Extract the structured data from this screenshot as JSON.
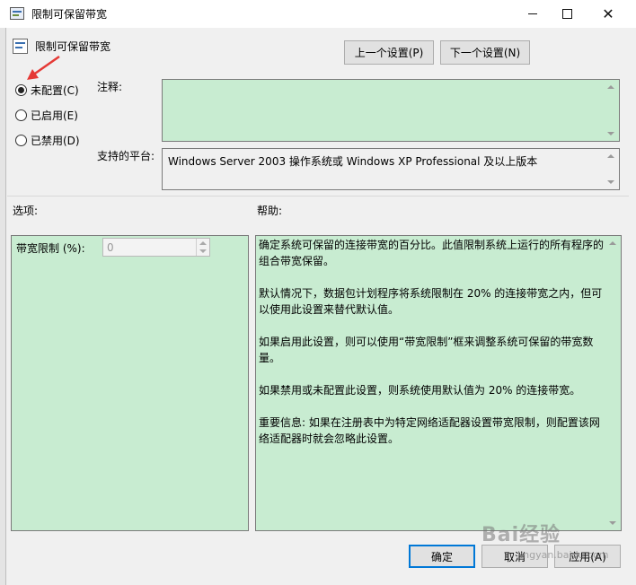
{
  "window": {
    "title": "限制可保留带宽"
  },
  "policy": {
    "title": "限制可保留带宽"
  },
  "nav": {
    "prev_label": "上一个设置(P)",
    "next_label": "下一个设置(N)"
  },
  "state": {
    "options": [
      {
        "label": "未配置(C)",
        "checked": true
      },
      {
        "label": "已启用(E)",
        "checked": false
      },
      {
        "label": "已禁用(D)",
        "checked": false
      }
    ]
  },
  "comment": {
    "label": "注释:",
    "value": ""
  },
  "platform": {
    "label": "支持的平台:",
    "value": "Windows Server 2003 操作系统或 Windows XP Professional 及以上版本"
  },
  "options_section": {
    "label": "选项:",
    "bandwidth_label": "带宽限制 (%):",
    "bandwidth_value": "0"
  },
  "help_section": {
    "label": "帮助:",
    "paragraphs": [
      "确定系统可保留的连接带宽的百分比。此值限制系统上运行的所有程序的组合带宽保留。",
      "默认情况下，数据包计划程序将系统限制在 20% 的连接带宽之内，但可以使用此设置来替代默认值。",
      "如果启用此设置，则可以使用“带宽限制”框来调整系统可保留的带宽数量。",
      "如果禁用或未配置此设置，则系统使用默认值为 20% 的连接带宽。",
      "重要信息: 如果在注册表中为特定网络适配器设置带宽限制，则配置该网络适配器时就会忽略此设置。"
    ]
  },
  "footer": {
    "ok_label": "确定",
    "cancel_label": "取消",
    "apply_label": "应用(A)"
  },
  "watermark": {
    "text": "Bai经验",
    "sub": "jingyan.baidu.com"
  },
  "colors": {
    "green_panel": "#c8ecd1",
    "accent": "#0078d7",
    "arrow": "#e53935"
  }
}
